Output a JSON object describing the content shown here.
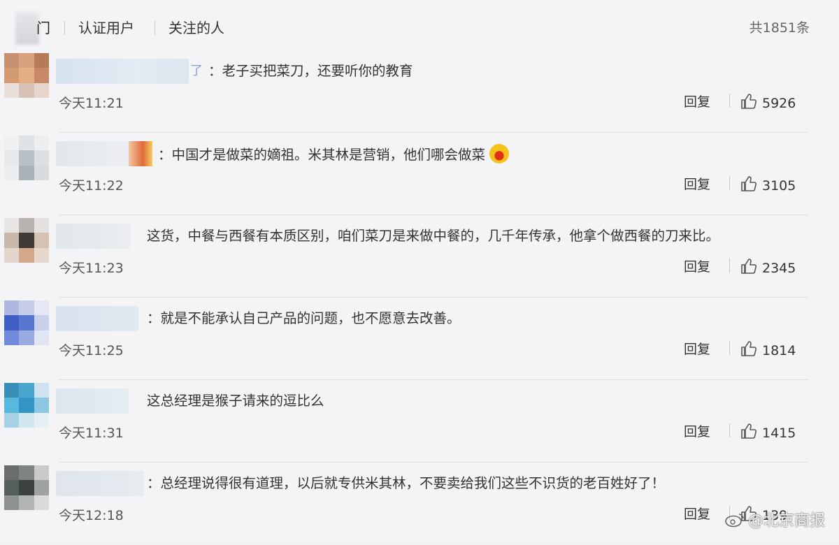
{
  "header": {
    "tab_hot_fragment": "门",
    "tab_verified": "认证用户",
    "tab_following": "关注的人",
    "total": "共1851条"
  },
  "actions": {
    "reply_label": "回复"
  },
  "comments": [
    {
      "name_tail": "了",
      "text": "：老子买把菜刀，还要听你的教育",
      "time": "今天11:21",
      "likes": "5926"
    },
    {
      "name_tail": "",
      "text": "：中国才是做菜的嫡祖。米其林是营销，他们哪会做菜",
      "time": "今天11:22",
      "likes": "3105"
    },
    {
      "name_tail": "",
      "text": "这货，中餐与西餐有本质区别，咱们菜刀是来做中餐的，几千年传承，他拿个做西餐的刀来比。",
      "time": "今天11:23",
      "likes": "2345"
    },
    {
      "name_tail": "",
      "text": "：就是不能承认自己产品的问题，也不愿意去改善。",
      "time": "今天11:25",
      "likes": "1814"
    },
    {
      "name_tail": "",
      "text": "这总经理是猴子请来的逗比么",
      "time": "今天11:31",
      "likes": "1415"
    },
    {
      "name_tail": "",
      "text": "：总经理说得很有道理，以后就专供米其林，不要卖给我们这些不识货的老百姓好了！",
      "time": "今天12:18",
      "likes": "139"
    }
  ],
  "watermark": {
    "text": "@北京商报"
  },
  "colors": {
    "like_icon": "#555555",
    "emoji_face": "#f6c21b"
  }
}
